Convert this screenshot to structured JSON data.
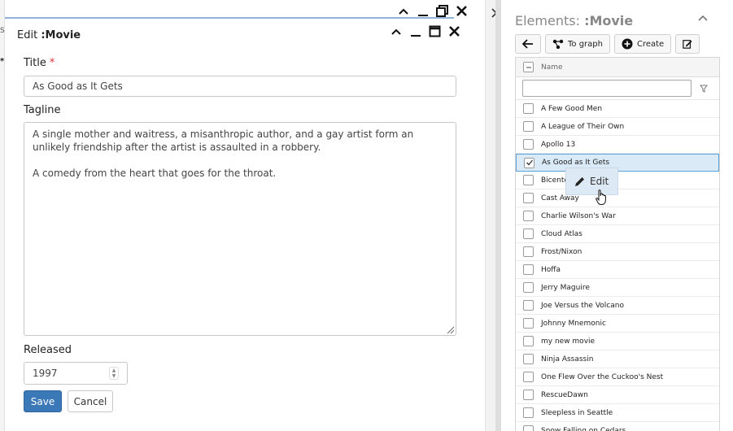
{
  "background_window": {
    "fragment_top": "Sc",
    "fragment_mid": "*"
  },
  "editor": {
    "title_prefix": "Edit ",
    "title_type": ":Movie",
    "title_label": "Title",
    "required_mark": "*",
    "title_value": "As Good as It Gets",
    "tagline_label": "Tagline",
    "tagline_value": "A single mother and waitress, a misanthropic author, and a gay artist form an unlikely friendship after the artist is assaulted in a robbery.\n\nA comedy from the heart that goes for the throat.",
    "released_label": "Released",
    "released_value": "1997",
    "save_label": "Save",
    "cancel_label": "Cancel"
  },
  "elements_panel": {
    "title_prefix": "Elements: ",
    "title_type": ":Movie",
    "toolbar": {
      "to_graph_label": "To graph",
      "create_label": "Create"
    },
    "column_name": "Name",
    "rows": [
      {
        "name": "A Few Good Men",
        "checked": false
      },
      {
        "name": "A League of Their Own",
        "checked": false
      },
      {
        "name": "Apollo 13",
        "checked": false
      },
      {
        "name": "As Good as It Gets",
        "checked": true
      },
      {
        "name": "Bicente",
        "checked": false
      },
      {
        "name": "Cast Away",
        "checked": false
      },
      {
        "name": "Charlie Wilson's War",
        "checked": false
      },
      {
        "name": "Cloud Atlas",
        "checked": false
      },
      {
        "name": "Frost/Nixon",
        "checked": false
      },
      {
        "name": "Hoffa",
        "checked": false
      },
      {
        "name": "Jerry Maguire",
        "checked": false
      },
      {
        "name": "Joe Versus the Volcano",
        "checked": false
      },
      {
        "name": "Johnny Mnemonic",
        "checked": false
      },
      {
        "name": "my new movie",
        "checked": false
      },
      {
        "name": "Ninja Assassin",
        "checked": false
      },
      {
        "name": "One Flew Over the Cuckoo's Nest",
        "checked": false
      },
      {
        "name": "RescueDawn",
        "checked": false
      },
      {
        "name": "Sleepless in Seattle",
        "checked": false
      },
      {
        "name": "Snow Falling on Cedars",
        "checked": false
      }
    ],
    "tooltip_label": "Edit"
  },
  "colors": {
    "accent": "#3a78b8",
    "selected_row": "#dbeaf7",
    "selected_border": "#5aa0d8",
    "tooltip_bg": "#dde9f4"
  }
}
